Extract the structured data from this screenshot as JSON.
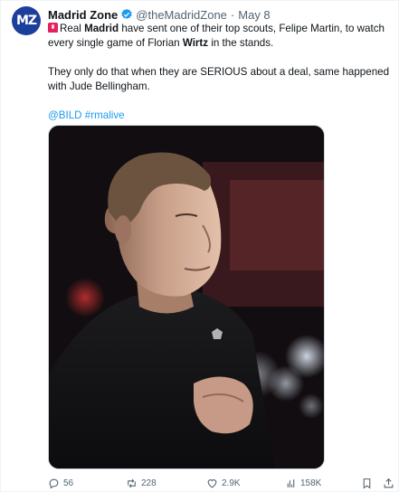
{
  "tweet": {
    "avatar_text": "MZ",
    "display_name": "Madrid Zone",
    "handle": "@theMadridZone",
    "separator": "·",
    "date": "May 8",
    "body": {
      "line1_a": "Real ",
      "line1_b": "Madrid",
      "line1_c": " have sent one of their top scouts, Felipe Martin, to watch every single game of Florian ",
      "line1_d": "Wirtz",
      "line1_e": " in the stands.",
      "line2": "They only do that when they are SERIOUS about a deal, same happened with Jude Bellingham.",
      "mention": "@BILD",
      "hashtag": "#rmalive"
    },
    "media_alt": "Photo of a football player in a black top in a stadium"
  },
  "actions": {
    "replies": "56",
    "retweets": "228",
    "likes": "2.9K",
    "views": "158K"
  },
  "colors": {
    "accent": "#1d9bf0",
    "muted": "#536471",
    "text": "#0f1419"
  }
}
